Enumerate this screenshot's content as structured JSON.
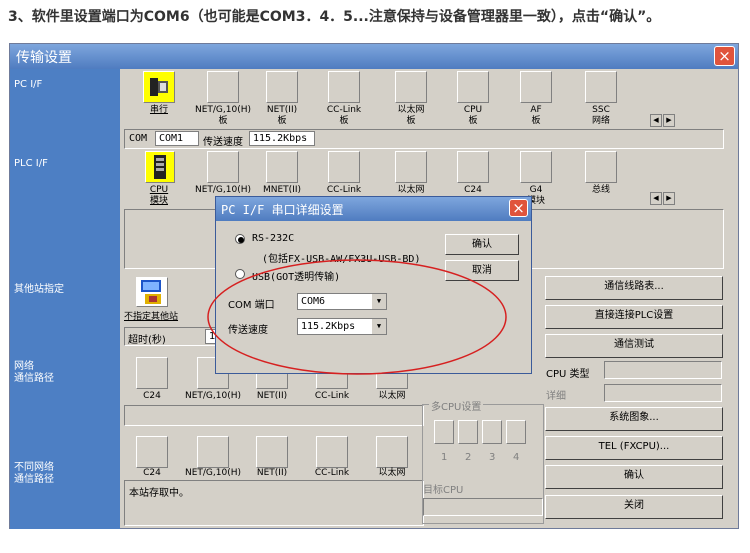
{
  "caption": "3、软件里设置端口为COM6（也可能是COM3．4．5...注意保持与设备管理器里一致），点击“确认”。",
  "window": {
    "title": "传输设置",
    "close": "×"
  },
  "sidebar": {
    "pc_if": "PC I/F",
    "plc_if": "PLC I/F",
    "other_station": "其他站指定",
    "network_route": "网络\n通信路径",
    "diff_network_route": "不同网络\n通信路径"
  },
  "pc_if": {
    "tiles": [
      {
        "label": "串行",
        "icon": "serial-cable-icon"
      },
      {
        "label": "NET/G,10(H)\n板"
      },
      {
        "label": "NET(II)\n板"
      },
      {
        "label": "CC-Link\n板"
      },
      {
        "label": "以太网\n板"
      },
      {
        "label": "CPU\n板"
      },
      {
        "label": "AF\n板"
      },
      {
        "label": "SSC\n网络"
      }
    ],
    "com_label": "COM",
    "com_value": "COM1",
    "speed_label": "传送速度",
    "speed_value": "115.2Kbps"
  },
  "plc_if": {
    "tiles": [
      {
        "label": "CPU\n模块",
        "icon": "plc-cpu-icon"
      },
      {
        "label": "NET/G,10(H)"
      },
      {
        "label": "MNET(II)"
      },
      {
        "label": "CC-Link"
      },
      {
        "label": "以太网"
      },
      {
        "label": "C24"
      },
      {
        "label": "G4\n模块"
      },
      {
        "label": "总线"
      }
    ]
  },
  "other_station": {
    "tile_label": "不指定其他站",
    "timeout_label": "超时(秒)",
    "timeout_value": "1"
  },
  "network_route": {
    "tiles": [
      "C24",
      "NET/G,10(H)",
      "NET(II)",
      "CC-Link",
      "以太网"
    ]
  },
  "diff_network": {
    "tiles": [
      "C24",
      "NET/G,10(H)",
      "NET(II)",
      "CC-Link",
      "以太网"
    ],
    "status": "本站存取中。"
  },
  "multi_cpu": {
    "title": "多CPU设置",
    "nums": [
      "1",
      "2",
      "3",
      "4"
    ],
    "target_label": "目标CPU"
  },
  "right_buttons": {
    "route_list": "通信线路表...",
    "direct_plc": "直接连接PLC设置",
    "comm_test": "通信测试",
    "cpu_type_label": "CPU 类型",
    "remark_label": "详细",
    "system_image": "系统图象...",
    "tel": "TEL  (FXCPU)...",
    "ok": "确认",
    "close": "关闭"
  },
  "dialog": {
    "title": "PC I/F 串口详细设置",
    "rs232c": "RS-232C",
    "rs232c_note": "(包括FX-USB-AW/FX3U-USB-BD)",
    "usb": "USB(GOT透明传输)",
    "ok": "确认",
    "cancel": "取消",
    "com_label": "COM 端口",
    "com_value": "COM6",
    "speed_label": "传送速度",
    "speed_value": "115.2Kbps"
  }
}
